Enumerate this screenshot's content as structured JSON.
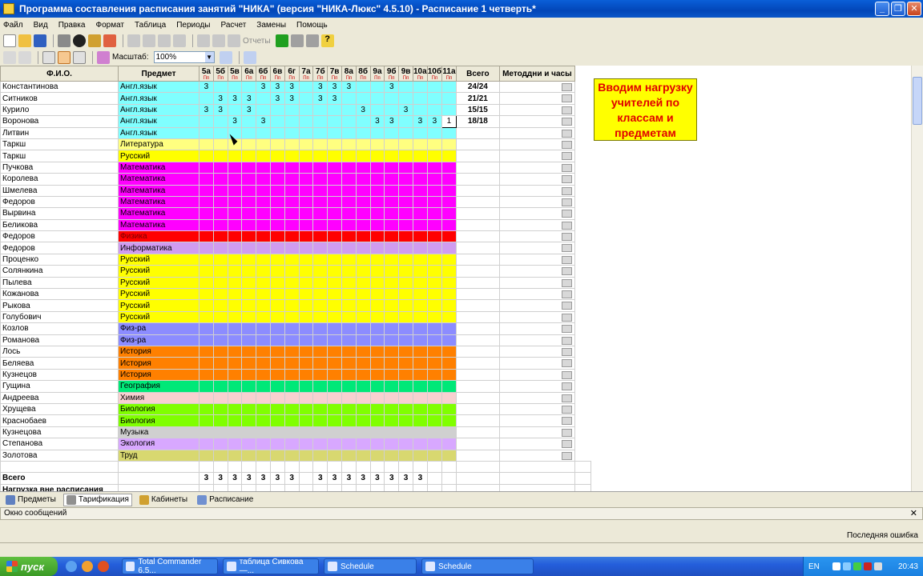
{
  "window": {
    "title": "Программа составления расписания занятий \"НИКА\" (версия \"НИКА-Люкс\" 4.5.10) - Расписание 1 четверть*"
  },
  "menu": [
    "Файл",
    "Вид",
    "Правка",
    "Формат",
    "Таблица",
    "Периоды",
    "Расчет",
    "Замены",
    "Помощь"
  ],
  "toolbar": {
    "reports_label": "Отчеты",
    "scale_label": "Масштаб:",
    "scale_value": "100%"
  },
  "grid": {
    "col_fio": "Ф.И.О.",
    "col_subject": "Предмет",
    "col_total": "Всего",
    "col_method": "Методдни и часы",
    "classes": [
      "5а",
      "5б",
      "5в",
      "6а",
      "6б",
      "6в",
      "6г",
      "7а",
      "7б",
      "7в",
      "8а",
      "8б",
      "9а",
      "9б",
      "9в",
      "10а",
      "10б",
      "11а"
    ],
    "class_subs": [
      "Пп",
      "Пп",
      "Пп",
      "Пп",
      "Пп",
      "Пп",
      "Пп",
      "Пп",
      "Пп",
      "Пп",
      "Пп",
      "Пп",
      "Пп",
      "Пп",
      "Пп",
      "Пп",
      "Пп",
      "Пп"
    ],
    "rows": [
      {
        "name": "Константинова",
        "subject": "Англ.язык",
        "color": "#80ffff",
        "textcolor": "#000000",
        "vals": [
          "3",
          "",
          "",
          "",
          "3",
          "3",
          "3",
          "",
          "3",
          "3",
          "3",
          "",
          "",
          "3",
          "",
          "",
          "",
          ""
        ],
        "total": "24/24"
      },
      {
        "name": "Ситников",
        "subject": "Англ.язык",
        "color": "#80ffff",
        "textcolor": "#000000",
        "vals": [
          "",
          "3",
          "3",
          "3",
          "",
          "3",
          "3",
          "",
          "3",
          "3",
          "",
          "",
          "",
          "",
          "",
          "",
          "",
          ""
        ],
        "total": "21/21"
      },
      {
        "name": "Курило",
        "subject": "Англ.язык",
        "color": "#80ffff",
        "textcolor": "#000000",
        "vals": [
          "3",
          "3",
          "",
          "3",
          "",
          "",
          "",
          "",
          "",
          "",
          "",
          "3",
          "",
          "",
          "3",
          "",
          "",
          ""
        ],
        "total": "15/15"
      },
      {
        "name": "Воронова",
        "subject": "Англ.язык",
        "color": "#80ffff",
        "textcolor": "#000000",
        "vals": [
          "",
          "",
          "3",
          "",
          "3",
          "",
          "",
          "",
          "",
          "",
          "",
          "",
          "3",
          "3",
          "",
          "3",
          "3",
          "1"
        ],
        "total": "18/18"
      },
      {
        "name": "Литвин",
        "subject": "Англ.язык",
        "color": "#80ffff",
        "textcolor": "#000000",
        "vals": [],
        "total": ""
      },
      {
        "name": "Таркш",
        "subject": "Литература",
        "color": "#ffff80",
        "textcolor": "#000000",
        "vals": [],
        "total": ""
      },
      {
        "name": "Таркш",
        "subject": "Русский",
        "color": "#ffff00",
        "textcolor": "#000000",
        "vals": [],
        "total": ""
      },
      {
        "name": "Пучкова",
        "subject": "Математика",
        "color": "#ff00ff",
        "textcolor": "#000000",
        "vals": [],
        "total": ""
      },
      {
        "name": "Королева",
        "subject": "Математика",
        "color": "#ff00ff",
        "textcolor": "#000000",
        "vals": [],
        "total": ""
      },
      {
        "name": "Шмелева",
        "subject": "Математика",
        "color": "#ff00ff",
        "textcolor": "#000000",
        "vals": [],
        "total": ""
      },
      {
        "name": "Федоров",
        "subject": "Математика",
        "color": "#ff00ff",
        "textcolor": "#000000",
        "vals": [],
        "total": ""
      },
      {
        "name": "Вырвина",
        "subject": "Математика",
        "color": "#ff00ff",
        "textcolor": "#000000",
        "vals": [],
        "total": ""
      },
      {
        "name": "Беликова",
        "subject": "Математика",
        "color": "#ff00ff",
        "textcolor": "#000000",
        "vals": [],
        "total": ""
      },
      {
        "name": "Федоров",
        "subject": "Физика",
        "color": "#ff0000",
        "textcolor": "#7a0000",
        "vals": [],
        "total": ""
      },
      {
        "name": "Федоров",
        "subject": "Информатика",
        "color": "#d09cf0",
        "textcolor": "#000000",
        "vals": [],
        "total": ""
      },
      {
        "name": "Проценко",
        "subject": "Русский",
        "color": "#ffff00",
        "textcolor": "#000000",
        "vals": [],
        "total": ""
      },
      {
        "name": "Солянкина",
        "subject": "Русский",
        "color": "#ffff00",
        "textcolor": "#000000",
        "vals": [],
        "total": ""
      },
      {
        "name": "Пылева",
        "subject": "Русский",
        "color": "#ffff00",
        "textcolor": "#000000",
        "vals": [],
        "total": ""
      },
      {
        "name": "Кожанова",
        "subject": "Русский",
        "color": "#ffff00",
        "textcolor": "#000000",
        "vals": [],
        "total": ""
      },
      {
        "name": "Рыкова",
        "subject": "Русский",
        "color": "#ffff00",
        "textcolor": "#000000",
        "vals": [],
        "total": ""
      },
      {
        "name": "Голубович",
        "subject": "Русский",
        "color": "#ffff00",
        "textcolor": "#000000",
        "vals": [],
        "total": ""
      },
      {
        "name": "Козлов",
        "subject": "Физ-ра",
        "color": "#8c8cff",
        "textcolor": "#000000",
        "vals": [],
        "total": ""
      },
      {
        "name": "Романова",
        "subject": "Физ-ра",
        "color": "#8c8cff",
        "textcolor": "#000000",
        "vals": [],
        "total": ""
      },
      {
        "name": "Лось",
        "subject": "История",
        "color": "#ff8000",
        "textcolor": "#000000",
        "vals": [],
        "total": ""
      },
      {
        "name": "Беляева",
        "subject": "История",
        "color": "#ff8000",
        "textcolor": "#000000",
        "vals": [],
        "total": ""
      },
      {
        "name": "Кузнецов",
        "subject": "История",
        "color": "#ff8000",
        "textcolor": "#000000",
        "vals": [],
        "total": ""
      },
      {
        "name": "Гущина",
        "subject": "География",
        "color": "#00e878",
        "textcolor": "#000000",
        "vals": [],
        "total": ""
      },
      {
        "name": "Андреева",
        "subject": "Химия",
        "color": "#f8d0d0",
        "textcolor": "#000000",
        "vals": [],
        "total": ""
      },
      {
        "name": "Хрущева",
        "subject": "Биология",
        "color": "#80ff00",
        "textcolor": "#000000",
        "vals": [],
        "total": ""
      },
      {
        "name": "Краснобаев",
        "subject": "Биология",
        "color": "#80ff00",
        "textcolor": "#000000",
        "vals": [],
        "total": ""
      },
      {
        "name": "Кузнецова",
        "subject": "Музыка",
        "color": "#d0d0d0",
        "textcolor": "#000000",
        "vals": [],
        "total": ""
      },
      {
        "name": "Степанова",
        "subject": "Экология",
        "color": "#d8a8ff",
        "textcolor": "#000000",
        "vals": [],
        "total": ""
      },
      {
        "name": "Золотова",
        "subject": "Труд",
        "color": "#d8d870",
        "textcolor": "#000000",
        "vals": [],
        "total": ""
      }
    ],
    "footer_total_label": "Всего",
    "footer_total_vals": [
      "3",
      "3",
      "3",
      "3",
      "3",
      "3",
      "3",
      "",
      "3",
      "3",
      "3",
      "3",
      "3",
      "3",
      "3",
      "3",
      "",
      ""
    ],
    "footer_extra_label": "Нагрузка вне расписания"
  },
  "callout": {
    "text": "Вводим нагрузку учителей по классам и предметам"
  },
  "tabs": [
    {
      "label": "Предметы",
      "active": false
    },
    {
      "label": "Тарификация",
      "active": true
    },
    {
      "label": "Кабинеты",
      "active": false
    },
    {
      "label": "Расписание",
      "active": false
    }
  ],
  "messages": {
    "title": "Окно сообщений",
    "last_error": "Последняя ошибка"
  },
  "taskbar": {
    "start": "пуск",
    "tasks": [
      "Total Commander 6.5...",
      "таблица Сивкова —...",
      "Schedule",
      "Schedule"
    ],
    "lang": "EN",
    "time": "20:43"
  }
}
